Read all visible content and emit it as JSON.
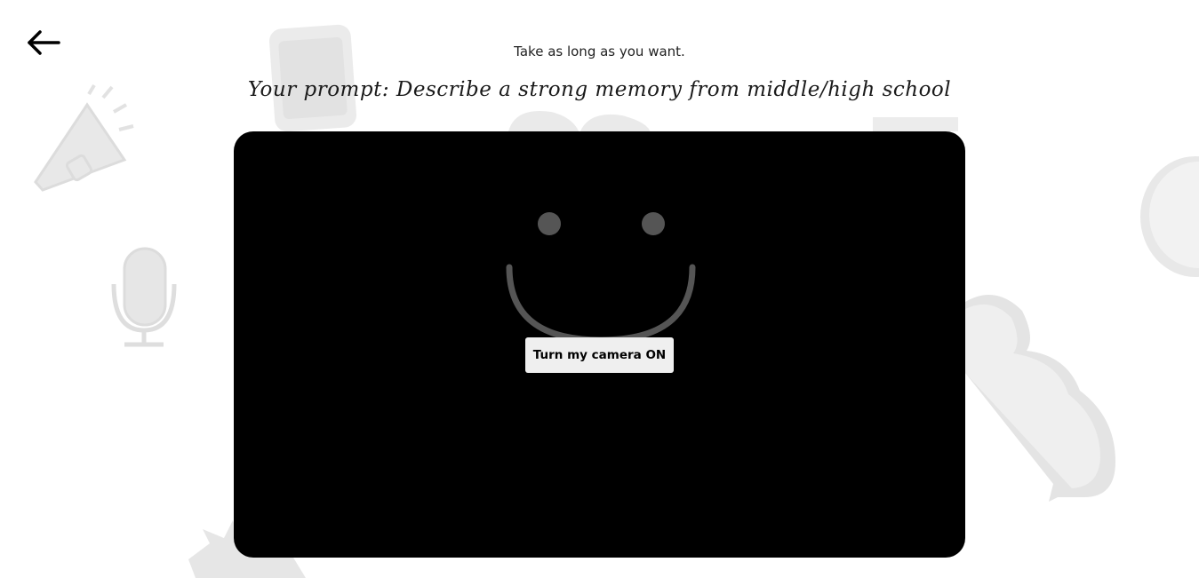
{
  "header": {
    "subtitle": "Take as long as you want.",
    "prompt_title": "Your prompt: Describe a strong memory from middle/high school"
  },
  "camera": {
    "button_label": "Turn my camera ON"
  },
  "icons": {
    "back": "arrow-left-icon",
    "placeholder": "smiley-face-icon",
    "decorations": [
      "phone-doodle",
      "megaphone-doodle",
      "microphone-doodle",
      "cloud-doodle",
      "speech-bubble-doodle",
      "starburst-doodle",
      "heart-doodle"
    ]
  },
  "colors": {
    "panel": "#000000",
    "button_bg": "#efefef",
    "smiley": "#555555",
    "doodle": "#e6e6e6"
  }
}
